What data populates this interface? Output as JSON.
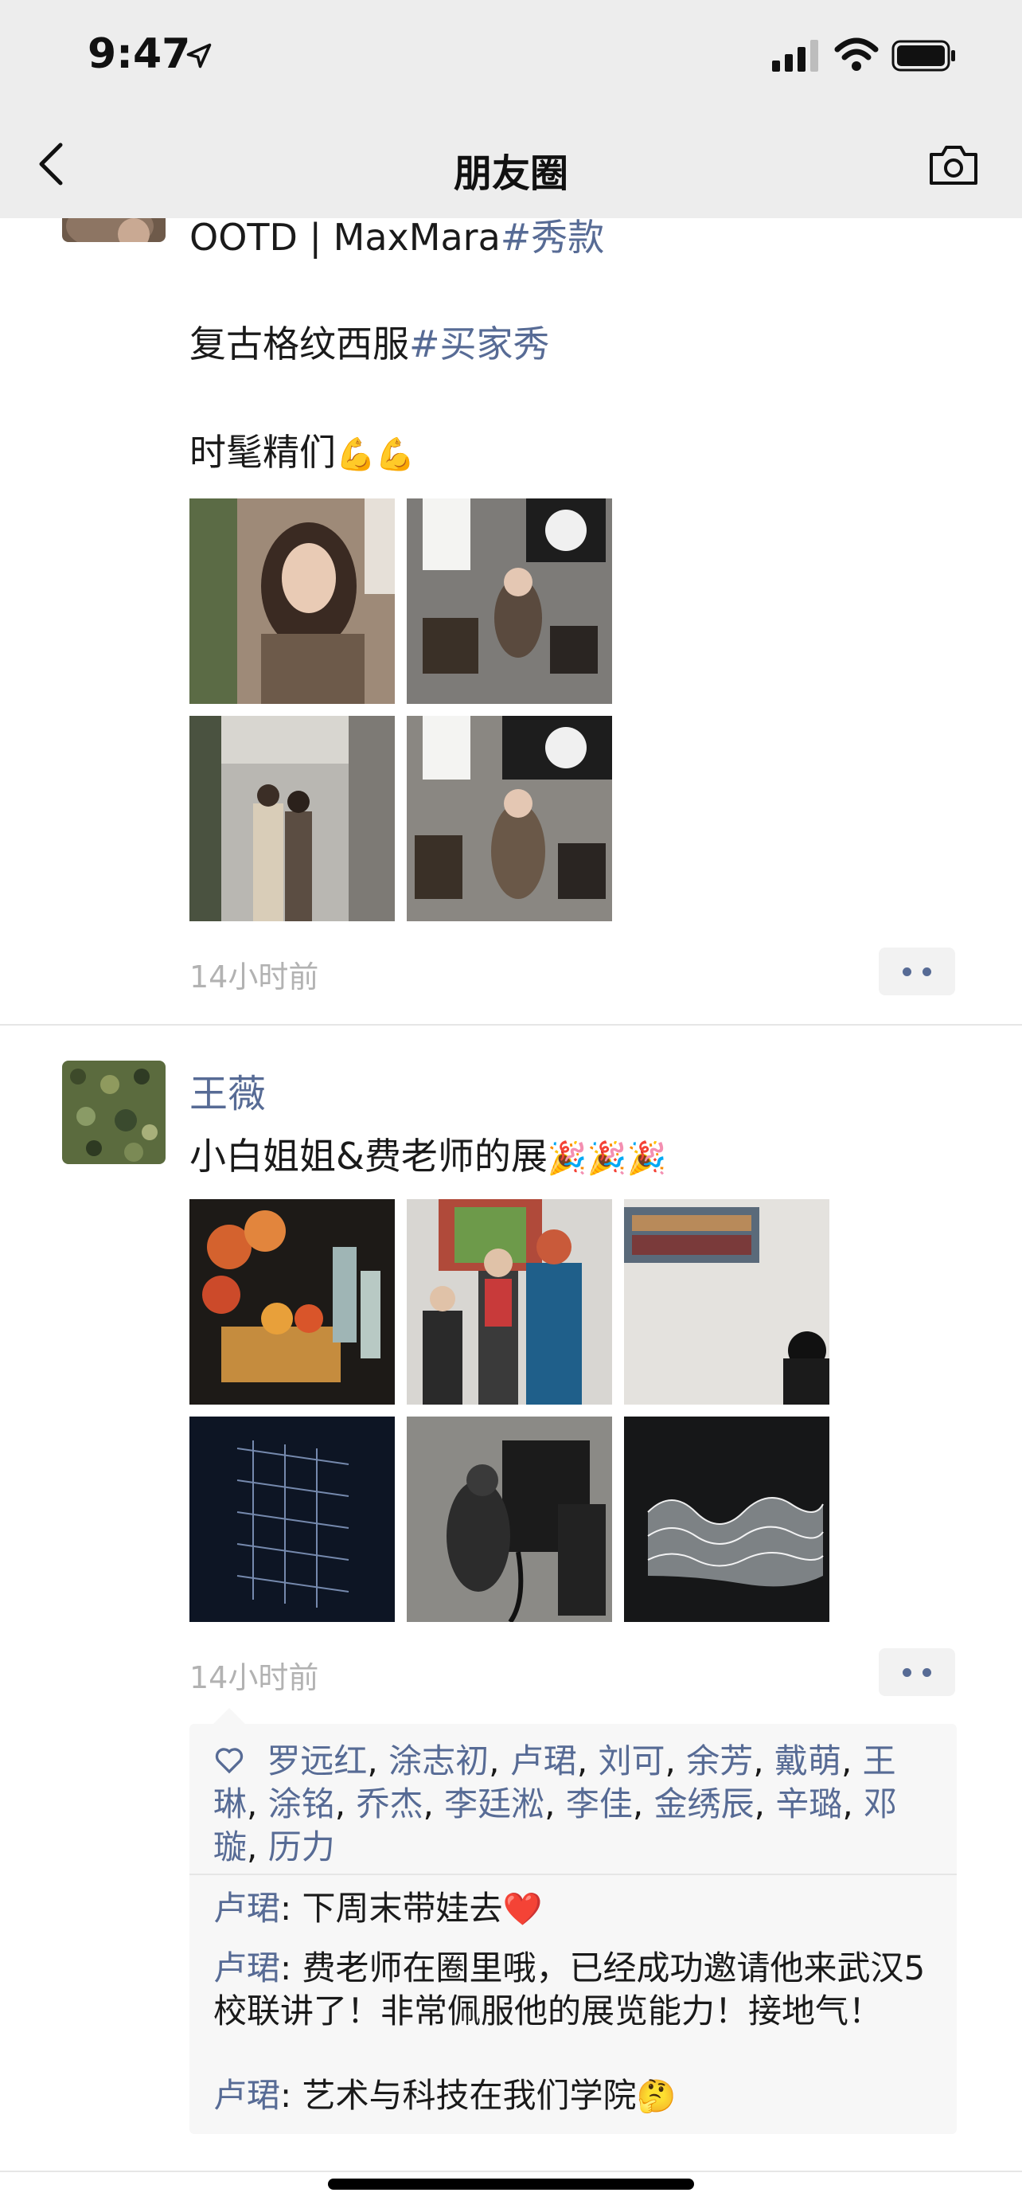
{
  "status_bar": {
    "time": "9:47"
  },
  "nav": {
    "title": "朋友圈"
  },
  "post1": {
    "title_plain": "OOTD | MaxMara",
    "title_tag": "#秀款",
    "line2_plain": "复古格纹西服",
    "line2_tag": "#买家秀",
    "line3_text": "时髦精们",
    "line3_emoji": "💪💪",
    "time": "14小时前"
  },
  "post2": {
    "author": "王薇",
    "text": "小白姐姐&费老师的展",
    "text_emoji": "🎉🎉🎉",
    "time": "14小时前",
    "likes": [
      "罗远红",
      "涂志初",
      "卢珺",
      "刘可",
      "余芳",
      "戴萌",
      "王琳",
      "涂铭",
      "乔杰",
      "李廷淞",
      "李佳",
      "金绣辰",
      "辛璐",
      "邓璇",
      "历力"
    ],
    "comments": [
      {
        "name": "卢珺",
        "text": ": 下周末带娃去",
        "emoji": "❤️"
      },
      {
        "name": "卢珺",
        "text": ": 费老师在圈里哦，已经成功邀请他来武汉5校联讲了！非常佩服他的展览能力！接地气！",
        "emoji": ""
      },
      {
        "name": "卢珺",
        "text": ": 艺术与科技在我们学院",
        "emoji": "🤔"
      }
    ]
  },
  "colors": {
    "link": "#576b95",
    "header_bg": "#ededed",
    "time_gray": "#b2b2b2"
  }
}
